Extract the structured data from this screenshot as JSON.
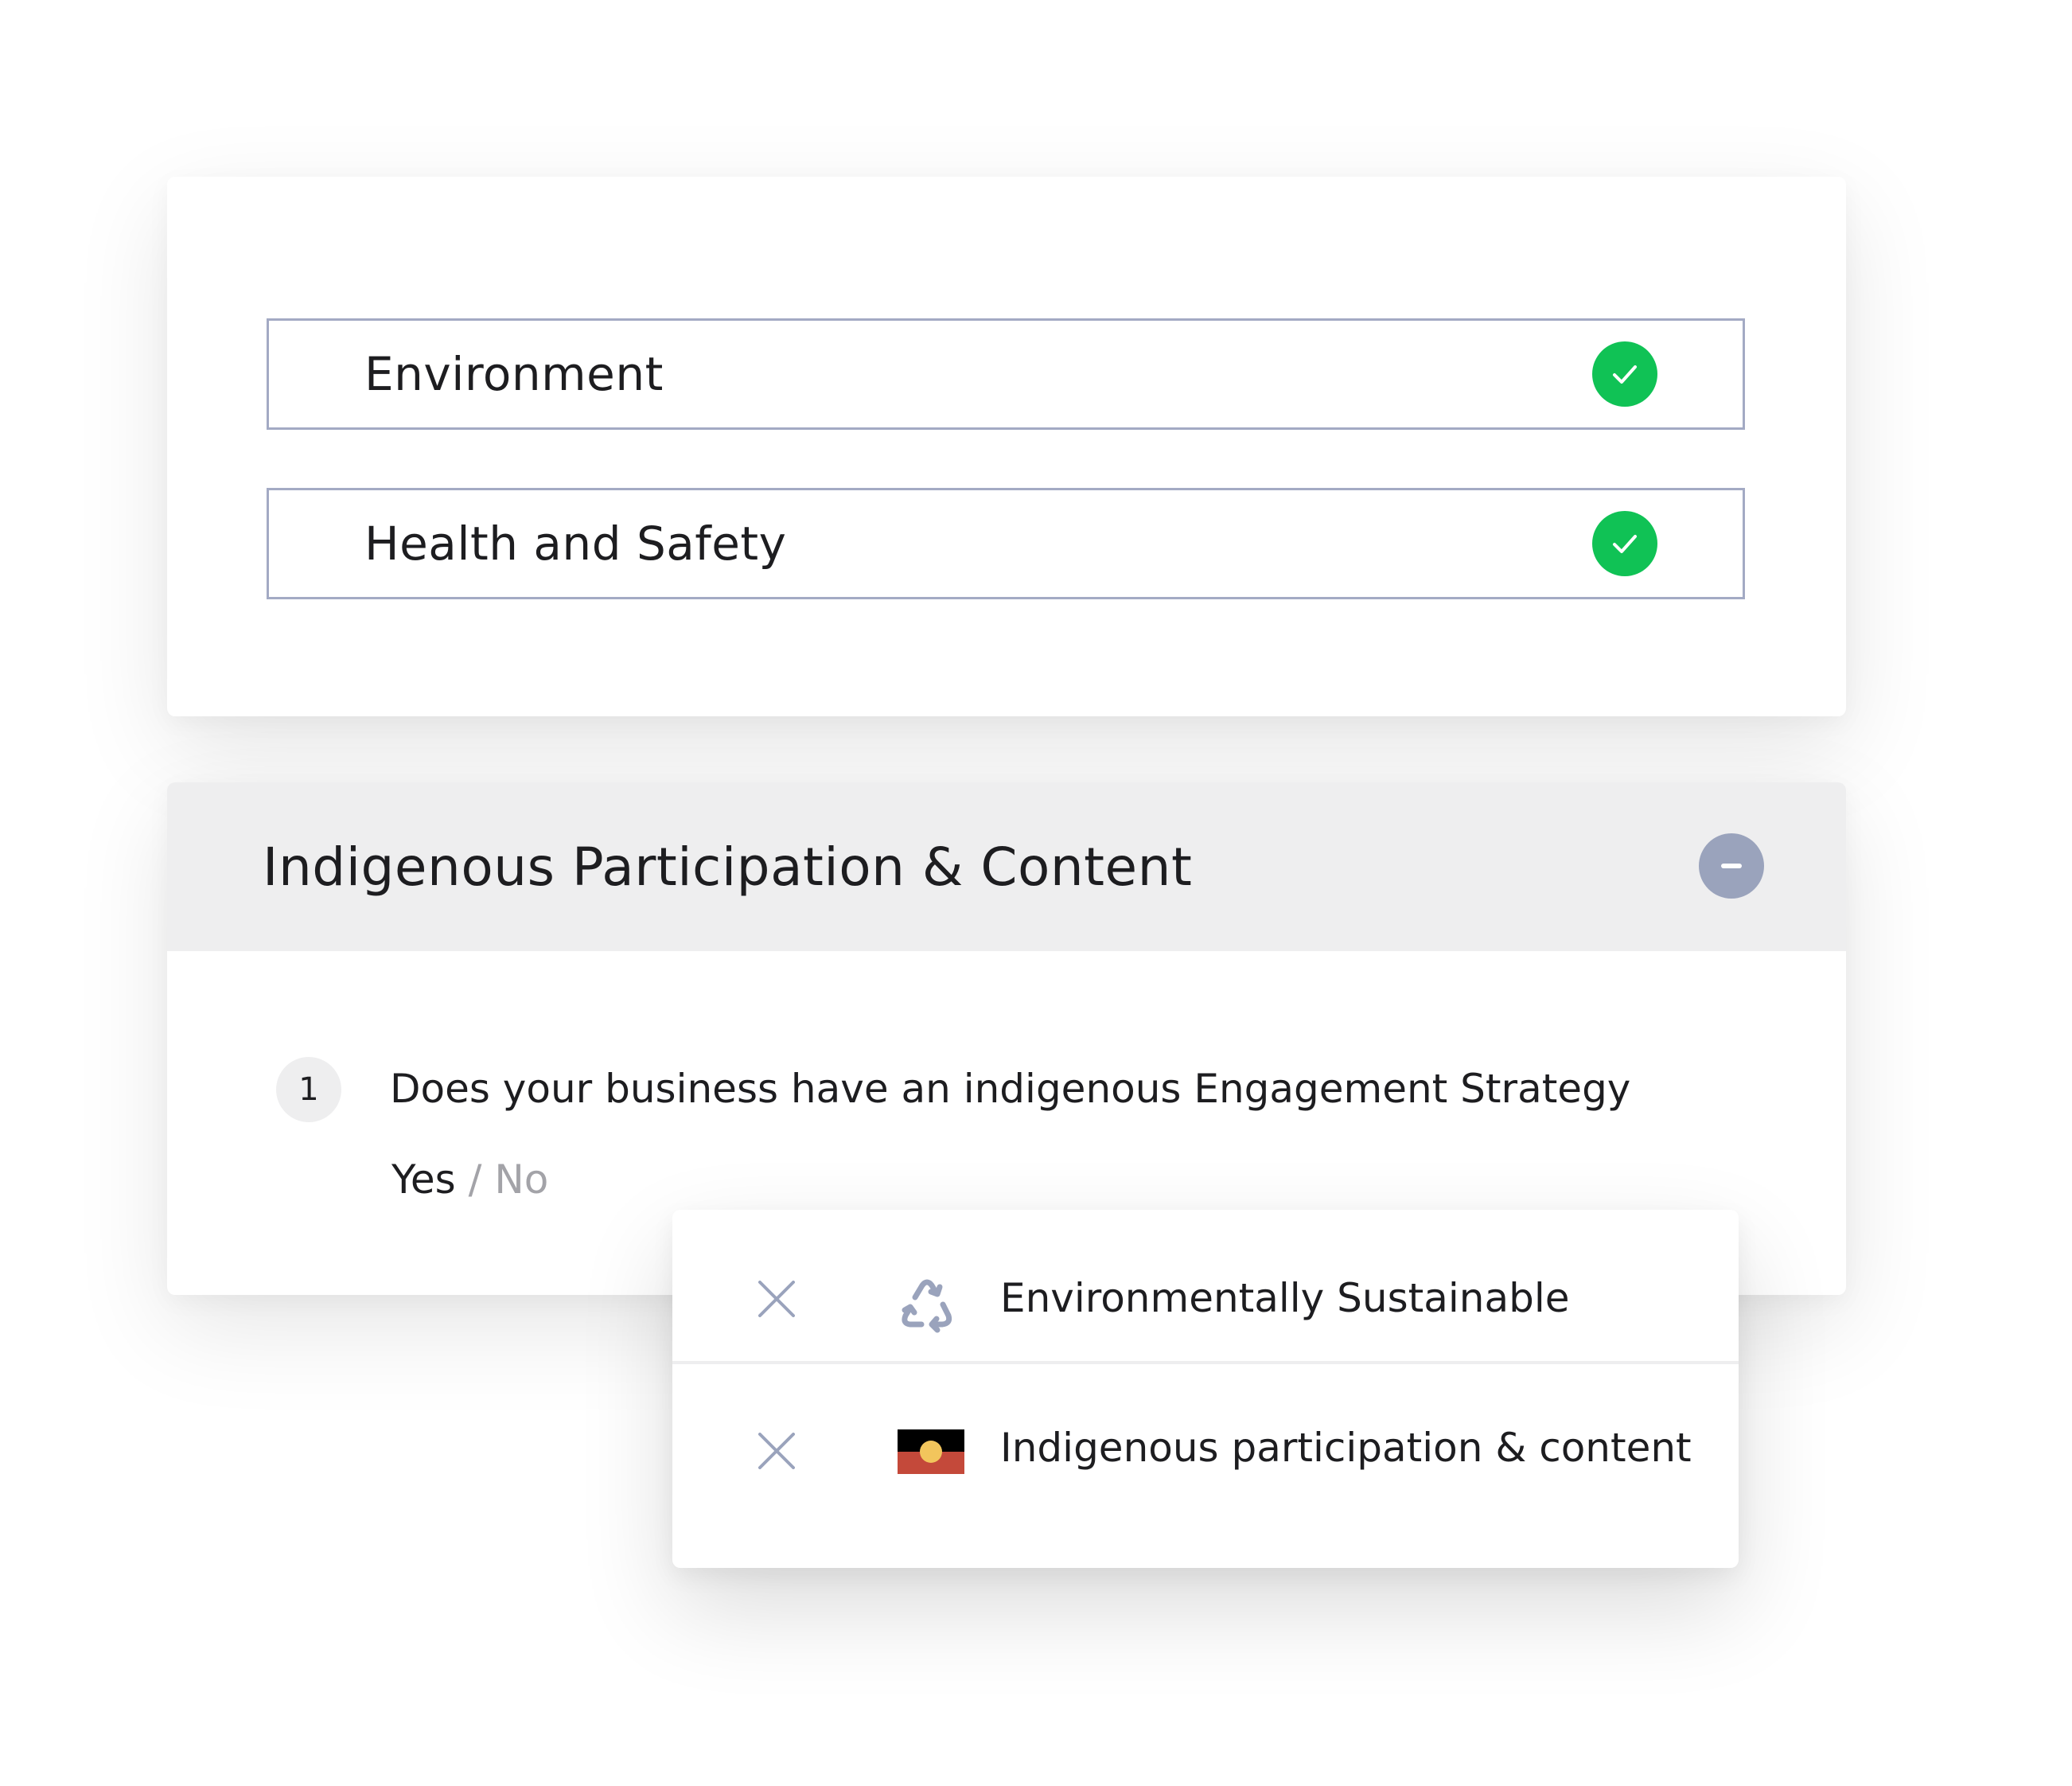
{
  "categories": [
    {
      "label": "Environment",
      "status": "checked"
    },
    {
      "label": "Health and Safety",
      "status": "checked"
    }
  ],
  "accordion": {
    "title": "Indigenous Participation & Content",
    "expanded": true,
    "question": {
      "number": "1",
      "text": "Does your business have an indigenous Engagement Strategy",
      "options": {
        "yes": "Yes",
        "separator": " / ",
        "no": "No"
      },
      "selected": "Yes"
    }
  },
  "tags": [
    {
      "label": "Environmentally Sustainable",
      "icon": "recycle-icon"
    },
    {
      "label": "Indigenous participation & content",
      "icon": "aboriginal-flag-icon"
    }
  ],
  "colors": {
    "check_green": "#10c255",
    "border_slate": "#a3aac4",
    "collapse_slate": "#9aa3bc",
    "header_gray": "#eeeeef",
    "text_dark": "#1d1d20",
    "text_muted": "#a3a3a8",
    "flag_black": "#000000",
    "flag_red": "#c4493a",
    "flag_yellow": "#f2c55c"
  }
}
